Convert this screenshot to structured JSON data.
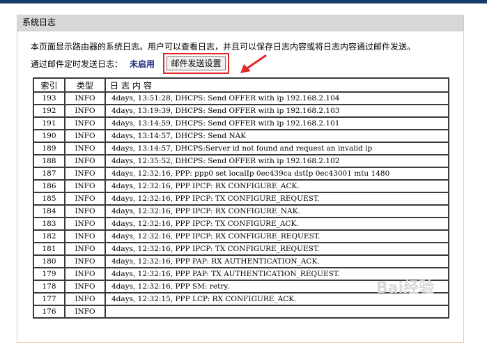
{
  "panel": {
    "title": "系统日志",
    "description": "本页面显示路由器的系统日志。用户可以查看日志，并且可以保存日志内容或将日志内容通过邮件发送。",
    "email_label": "通过邮件定时发送日志：",
    "email_status": "未启用",
    "email_button": "邮件发送设置"
  },
  "table": {
    "headers": {
      "index": "索引",
      "type": "类型",
      "content": "日志内容"
    },
    "rows": [
      {
        "index": "193",
        "type": "INFO",
        "content": "4days, 13:51:28, DHCPS: Send OFFER with ip 192.168.2.104"
      },
      {
        "index": "192",
        "type": "INFO",
        "content": "4days, 13:19:39, DHCPS: Send OFFER with ip 192.168.2.103"
      },
      {
        "index": "191",
        "type": "INFO",
        "content": "4days, 13:14:59, DHCPS: Send OFFER with ip 192.168.2.101"
      },
      {
        "index": "190",
        "type": "INFO",
        "content": "4days, 13:14:57, DHCPS: Send NAK"
      },
      {
        "index": "189",
        "type": "INFO",
        "content": "4days, 13:14:57, DHCPS:Server id not found and request an invalid ip"
      },
      {
        "index": "188",
        "type": "INFO",
        "content": "4days, 12:35:52, DHCPS: Send OFFER with ip 192.168.2.102"
      },
      {
        "index": "187",
        "type": "INFO",
        "content": "4days, 12:32:16, PPP: ppp0 set localIp 0ec439ca dstIp 0ec43001 mtu 1480"
      },
      {
        "index": "186",
        "type": "INFO",
        "content": "4days, 12:32:16, PPP IPCP: RX CONFIGURE_ACK."
      },
      {
        "index": "185",
        "type": "INFO",
        "content": "4days, 12:32:16, PPP IPCP: TX CONFIGURE_REQUEST."
      },
      {
        "index": "184",
        "type": "INFO",
        "content": "4days, 12:32:16, PPP IPCP: RX CONFIGURE_NAK."
      },
      {
        "index": "183",
        "type": "INFO",
        "content": "4days, 12:32:16, PPP IPCP: TX CONFIGURE_ACK."
      },
      {
        "index": "182",
        "type": "INFO",
        "content": "4days, 12:32:16, PPP IPCP: RX CONFIGURE_REQUEST."
      },
      {
        "index": "181",
        "type": "INFO",
        "content": "4days, 12:32:16, PPP IPCP: TX CONFIGURE_REQUEST."
      },
      {
        "index": "180",
        "type": "INFO",
        "content": "4days, 12:32:16, PPP PAP: RX AUTHENTICATION_ACK."
      },
      {
        "index": "179",
        "type": "INFO",
        "content": "4days, 12:32:16, PPP PAP: TX AUTHENTICATION_REQUEST."
      },
      {
        "index": "178",
        "type": "INFO",
        "content": "4days, 12:32:16, PPP SM: retry."
      },
      {
        "index": "177",
        "type": "INFO",
        "content": "4days, 12:32:15, PPP LCP: RX CONFIGURE_ACK."
      },
      {
        "index": "176",
        "type": "INFO",
        "content": ""
      }
    ]
  },
  "annotation": {
    "highlight_color": "#e32626"
  },
  "watermark": "Bai经验"
}
